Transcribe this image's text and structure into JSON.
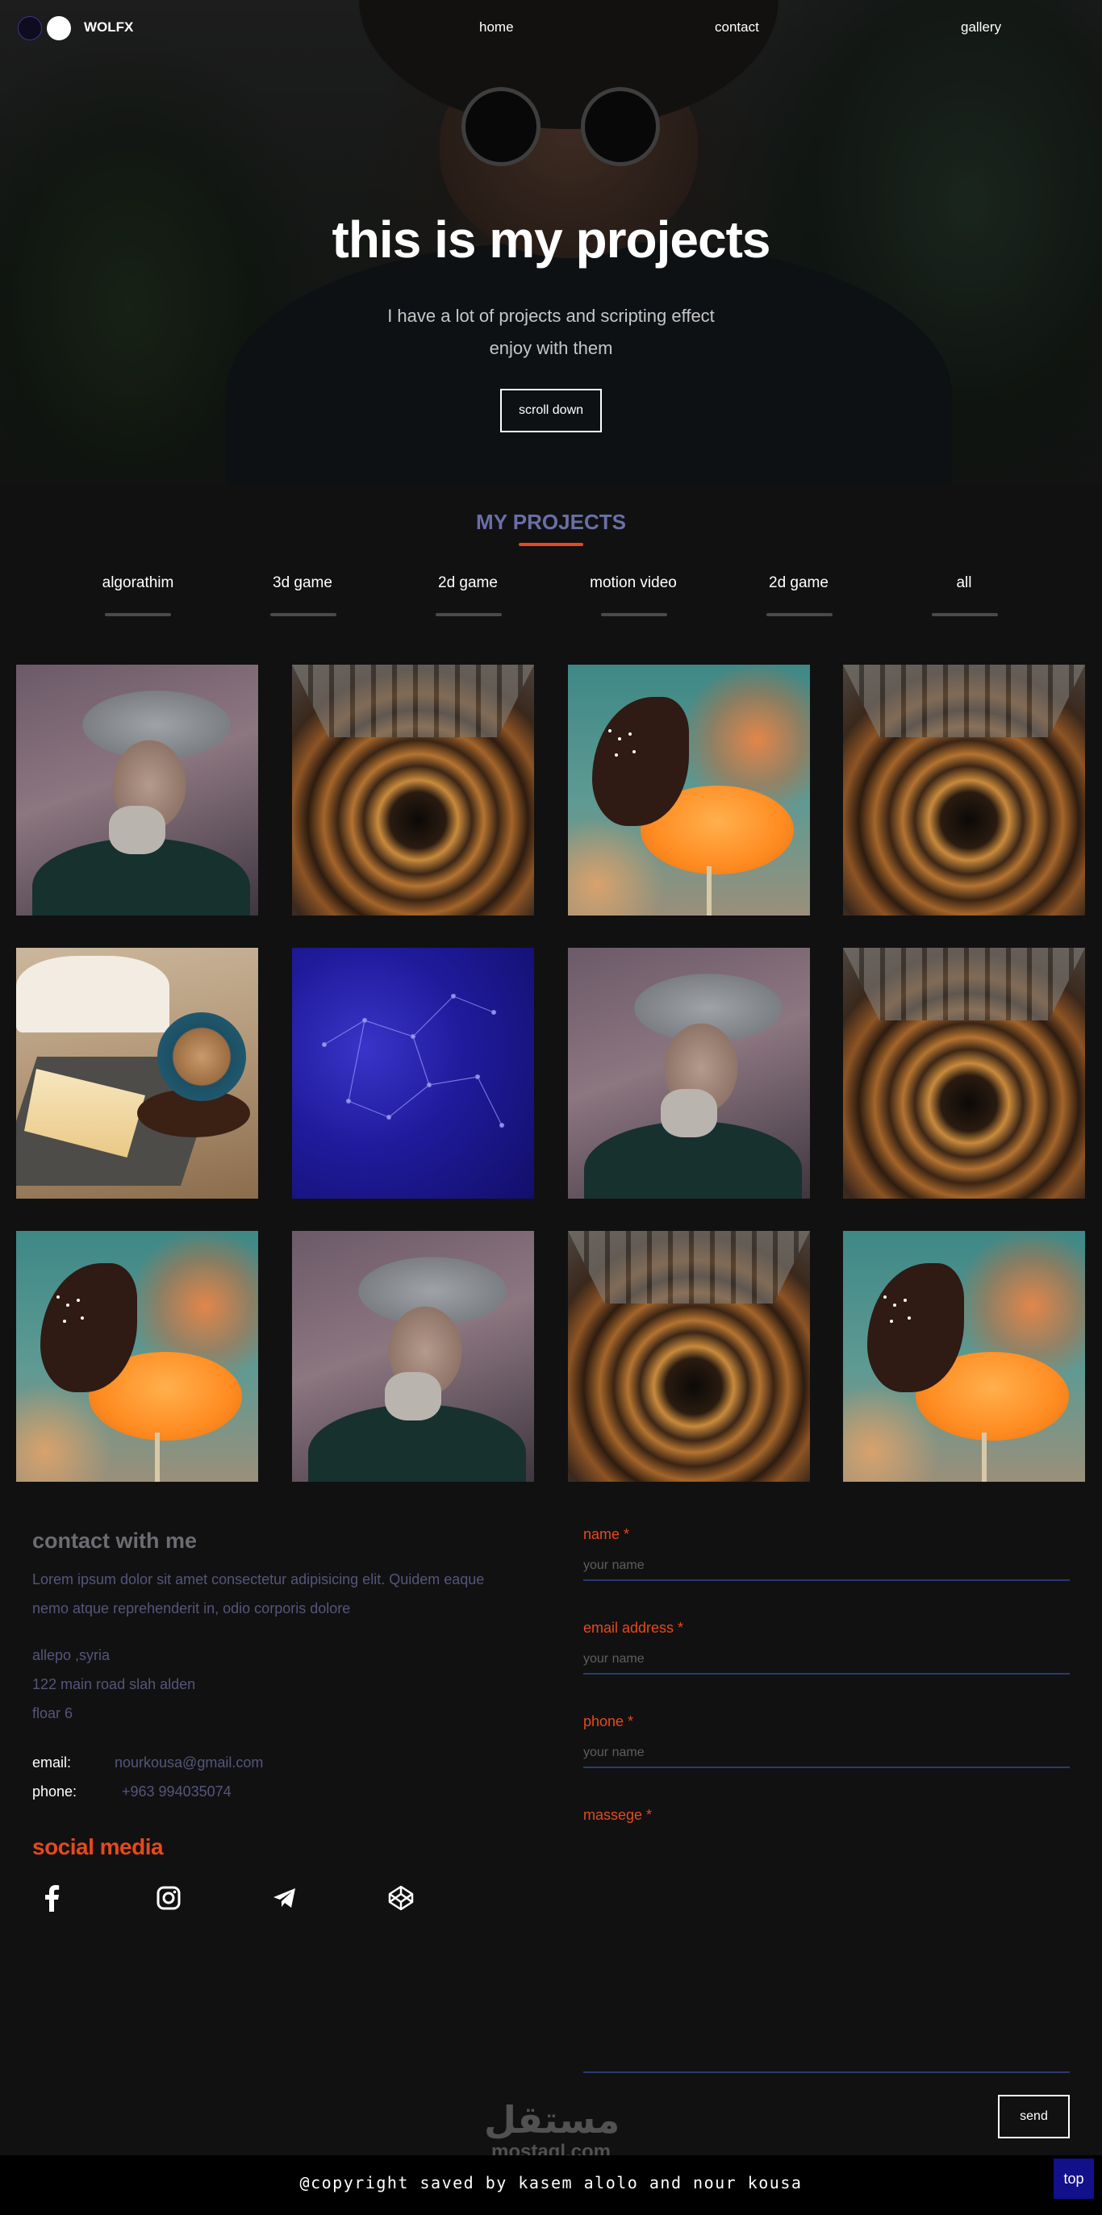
{
  "header": {
    "logo_text": "WOLFX",
    "nav": [
      {
        "label": "home"
      },
      {
        "label": "contact"
      },
      {
        "label": "gallery"
      }
    ]
  },
  "hero": {
    "title": "this is my projects",
    "subtitle_line1": "I have a lot of projects and scripting effect",
    "subtitle_line2": "enjoy with them",
    "button_label": "scroll down"
  },
  "projects": {
    "title": "MY PROJECTS",
    "accent_color": "#e6491d",
    "filters": [
      {
        "label": "algorathim"
      },
      {
        "label": "3d game"
      },
      {
        "label": "2d game"
      },
      {
        "label": "motion video"
      },
      {
        "label": "2d game"
      },
      {
        "label": "all"
      }
    ],
    "gallery": [
      {
        "image": "man-with-hat"
      },
      {
        "image": "spiral-staircase"
      },
      {
        "image": "butterfly-on-flower"
      },
      {
        "image": "spiral-staircase"
      },
      {
        "image": "cake-and-coffee"
      },
      {
        "image": "blue-network"
      },
      {
        "image": "man-with-hat"
      },
      {
        "image": "spiral-staircase"
      },
      {
        "image": "butterfly-on-flower"
      },
      {
        "image": "man-with-hat"
      },
      {
        "image": "spiral-staircase"
      },
      {
        "image": "butterfly-on-flower"
      }
    ]
  },
  "contact": {
    "title": "contact with me",
    "lorem_line1": "Lorem ipsum dolor sit amet consectetur adipisicing elit. Quidem eaque",
    "lorem_line2": "nemo atque reprehenderit in, odio corporis dolore",
    "address": [
      "allepo ,syria",
      "122 main road slah alden",
      "floar 6"
    ],
    "email_label": "email:",
    "email_value": "nourkousa@gmail.com",
    "phone_label": "phone:",
    "phone_value": "+963 994035074",
    "social_title": "social media",
    "social_icons": [
      "facebook-icon",
      "instagram-icon",
      "telegram-icon",
      "codepen-icon"
    ]
  },
  "form": {
    "name_label": "name *",
    "name_placeholder": "your name",
    "email_label": "email address *",
    "email_placeholder": "your name",
    "phone_label": "phone *",
    "phone_placeholder": "your name",
    "message_label": "massege *",
    "send_label": "send"
  },
  "footer": {
    "watermark_ar": "مستقل",
    "watermark_en": "mostaql.com",
    "copyright": "@copyright saved by kasem alolo and nour kousa",
    "top_label": "top"
  }
}
